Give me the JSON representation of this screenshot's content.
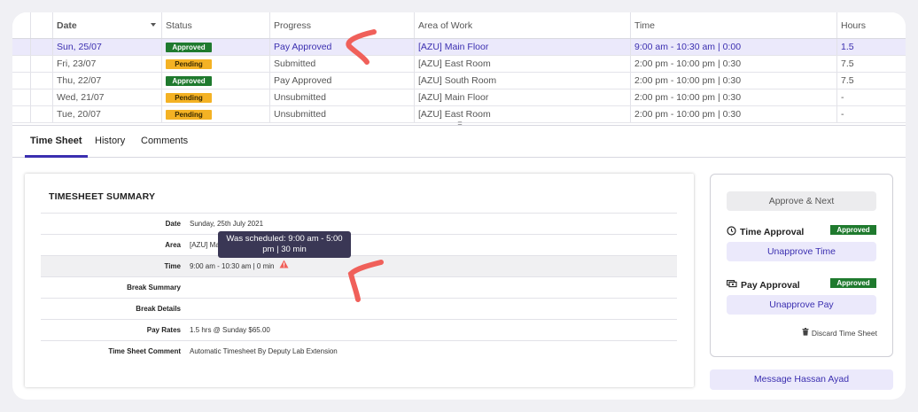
{
  "table": {
    "headers": {
      "date": "Date",
      "status": "Status",
      "progress": "Progress",
      "area": "Area of Work",
      "time": "Time",
      "hours": "Hours"
    },
    "rows": [
      {
        "date": "Sun, 25/07",
        "status": "Approved",
        "progress": "Pay Approved",
        "area": "[AZU] Main Floor",
        "time": "9:00 am - 10:30 am | 0:00",
        "hours": "1.5"
      },
      {
        "date": "Fri, 23/07",
        "status": "Pending",
        "progress": "Submitted",
        "area": "[AZU] East Room",
        "time": "2:00 pm - 10:00 pm | 0:30",
        "hours": "7.5"
      },
      {
        "date": "Thu, 22/07",
        "status": "Approved",
        "progress": "Pay Approved",
        "area": "[AZU] South Room",
        "time": "2:00 pm - 10:00 pm | 0:30",
        "hours": "7.5"
      },
      {
        "date": "Wed, 21/07",
        "status": "Pending",
        "progress": "Unsubmitted",
        "area": "[AZU] Main Floor",
        "time": "2:00 pm - 10:00 pm | 0:30",
        "hours": "-"
      },
      {
        "date": "Tue, 20/07",
        "status": "Pending",
        "progress": "Unsubmitted",
        "area": "[AZU] East Room",
        "time": "2:00 pm - 10:00 pm | 0:30",
        "hours": "-"
      }
    ]
  },
  "tabs": [
    "Time Sheet",
    "History",
    "Comments"
  ],
  "summary": {
    "title": "TIMESHEET SUMMARY",
    "fields": [
      {
        "label": "Date",
        "value": "Sunday, 25th July 2021"
      },
      {
        "label": "Area",
        "value": "[AZU] Ma"
      },
      {
        "label": "Time",
        "value": "9:00 am - 10:30 am | 0 min"
      },
      {
        "label": "Break Summary",
        "value": ""
      },
      {
        "label": "Break Details",
        "value": ""
      },
      {
        "label": "Pay Rates",
        "value": "1.5 hrs @ Sunday $65.00"
      },
      {
        "label": "Time Sheet Comment",
        "value": "Automatic Timesheet By Deputy Lab Extension"
      }
    ],
    "tooltip": {
      "line1": "Was scheduled: 9:00 am - 5:00",
      "line2": "pm | 30 min"
    }
  },
  "side": {
    "approve_next": "Approve & Next",
    "time_approval": {
      "title": "Time Approval",
      "badge": "Approved",
      "button": "Unapprove Time"
    },
    "pay_approval": {
      "title": "Pay Approval",
      "badge": "Approved",
      "button": "Unapprove Pay"
    },
    "discard": "Discard Time Sheet"
  },
  "message_button": "Message Hassan Ayad",
  "colors": {
    "accent": "#3b2fb0",
    "approved": "#1f7a2e",
    "pending": "#f4b224",
    "annotation": "#f0605a",
    "tooltip_bg": "#3a3755"
  }
}
